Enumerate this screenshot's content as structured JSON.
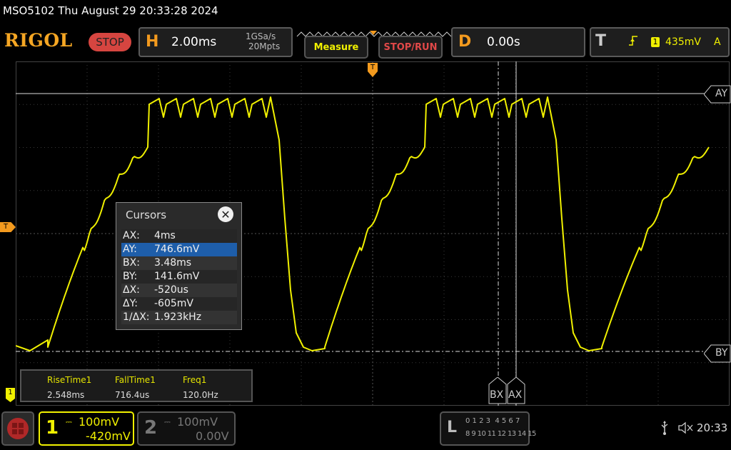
{
  "title": {
    "text": "MSO5102  Thu August 29 20:33:28 2024"
  },
  "header": {
    "logo": "RIGOL",
    "run_state": "STOP",
    "timebase": {
      "letter": "H",
      "value": "2.00ms",
      "rate": "1GSa/s",
      "depth": "20Mpts"
    },
    "measure_label": "Measure",
    "stoprun_label": "STOP/RUN",
    "delay": {
      "letter": "D",
      "value": "0.00s"
    },
    "trigger": {
      "letter": "T",
      "channel": "1",
      "level": "435mV",
      "mode": "A"
    }
  },
  "markers": {
    "trigger_level": "T",
    "trigger_pos": "T",
    "ay": "AY",
    "by": "BY",
    "bx": "BX",
    "ax": "AX",
    "ch1": "1"
  },
  "cursors": {
    "title": "Cursors",
    "close": "✕",
    "rows": [
      {
        "key": "AX:",
        "value": "4ms"
      },
      {
        "key": "AY:",
        "value": "746.6mV"
      },
      {
        "key": "BX:",
        "value": "3.48ms"
      },
      {
        "key": "BY:",
        "value": "141.6mV"
      },
      {
        "key": "ΔX:",
        "value": "-520us"
      },
      {
        "key": "ΔY:",
        "value": "-605mV"
      },
      {
        "key": "1/ΔX:",
        "value": "1.923kHz"
      }
    ]
  },
  "measurements": [
    {
      "label": "RiseTime1",
      "value": "2.548ms"
    },
    {
      "label": "FallTime1",
      "value": "716.4us"
    },
    {
      "label": "Freq1",
      "value": "120.0Hz"
    }
  ],
  "channels": [
    {
      "num": "1",
      "scale": "100mV",
      "offset": "-420mV"
    },
    {
      "num": "2",
      "scale": "100mV",
      "offset": "0.00V"
    }
  ],
  "logic": {
    "letter": "L",
    "row1": "0 1 2 3  4 5 6 7",
    "row2": "8 9 10 11 12 13 14 15"
  },
  "status": {
    "time": "20:33"
  },
  "colors": {
    "ch1": "#f0f000",
    "accent": "#f39a1e",
    "stop": "#d64540"
  }
}
